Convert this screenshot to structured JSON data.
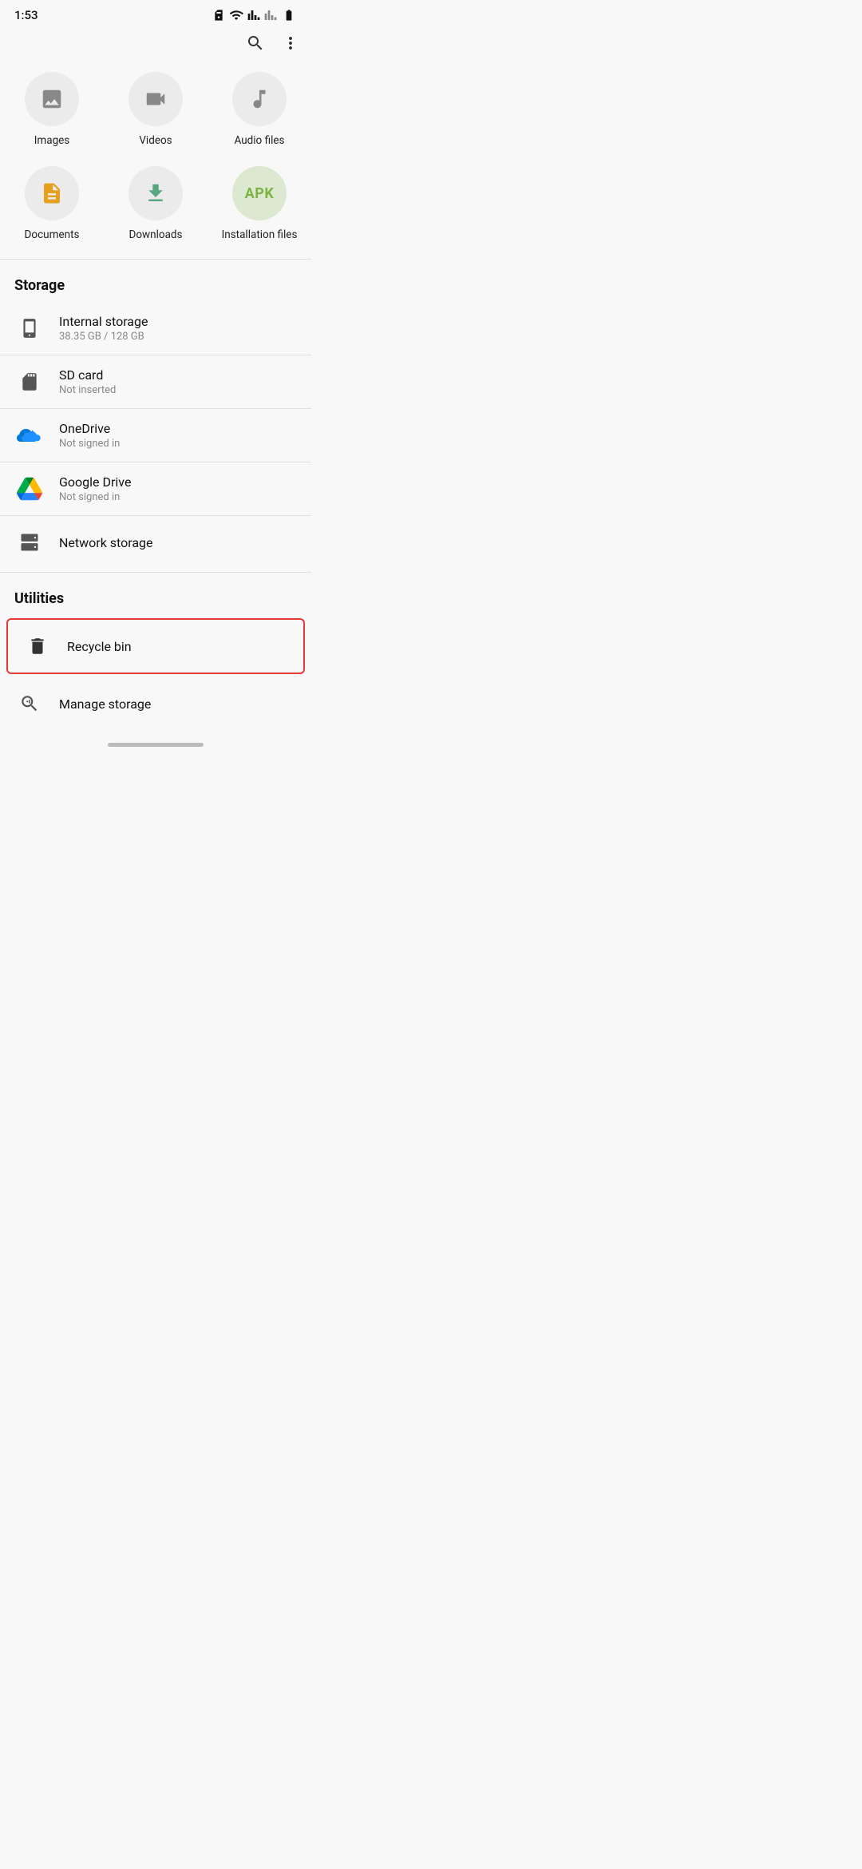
{
  "status_bar": {
    "time": "1:53"
  },
  "header": {
    "search_label": "Search",
    "menu_label": "More options"
  },
  "categories": [
    {
      "id": "images",
      "label": "Images",
      "icon": "image-icon"
    },
    {
      "id": "videos",
      "label": "Videos",
      "icon": "video-icon"
    },
    {
      "id": "audio",
      "label": "Audio files",
      "icon": "audio-icon"
    },
    {
      "id": "documents",
      "label": "Documents",
      "icon": "document-icon"
    },
    {
      "id": "downloads",
      "label": "Downloads",
      "icon": "download-icon"
    },
    {
      "id": "installation",
      "label": "Installation files",
      "icon": "apk-icon"
    }
  ],
  "storage_section": {
    "title": "Storage",
    "items": [
      {
        "id": "internal",
        "label": "Internal storage",
        "subtitle": "38.35 GB / 128 GB",
        "icon": "phone-icon"
      },
      {
        "id": "sdcard",
        "label": "SD card",
        "subtitle": "Not inserted",
        "icon": "sdcard-icon"
      },
      {
        "id": "onedrive",
        "label": "OneDrive",
        "subtitle": "Not signed in",
        "icon": "onedrive-icon"
      },
      {
        "id": "googledrive",
        "label": "Google Drive",
        "subtitle": "Not signed in",
        "icon": "googledrive-icon"
      },
      {
        "id": "network",
        "label": "Network storage",
        "icon": "network-icon"
      }
    ]
  },
  "utilities_section": {
    "title": "Utilities",
    "items": [
      {
        "id": "recyclebin",
        "label": "Recycle bin",
        "icon": "trash-icon",
        "highlighted": true
      },
      {
        "id": "managestorage",
        "label": "Manage storage",
        "icon": "manage-icon"
      }
    ]
  }
}
